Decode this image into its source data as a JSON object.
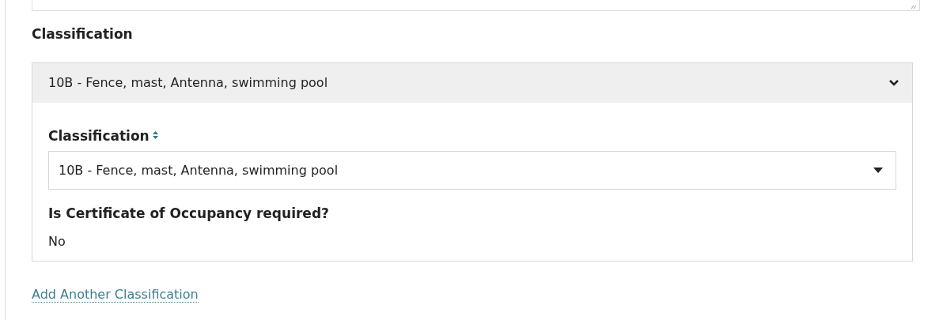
{
  "section": {
    "heading": "Classification"
  },
  "classifications": [
    {
      "summary": "10B - Fence, mast, Antenna, swimming pool",
      "expanded": true,
      "field_label": "Classification",
      "required": true,
      "value": "10B - Fence, mast, Antenna, swimming pool",
      "question": "Is Certificate of Occupancy required?",
      "answer": "No"
    }
  ],
  "add_link": "Add Another Classification"
}
